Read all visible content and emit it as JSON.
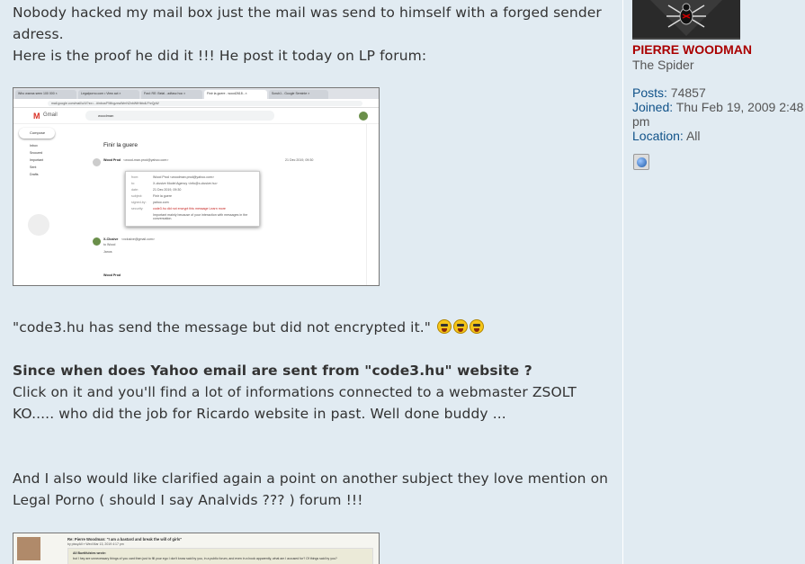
{
  "post": {
    "line1": "Nobody hacked my mail box just the mail was send to himself with a forged sender",
    "line2": "adress.",
    "line3": "Here is the proof he did it !!! He post it today on LP forum:",
    "quote_line": "\"code3.hu has send the message but did not encrypted it.\"",
    "question": "Since when does Yahoo email are sent from \"code3.hu\" website ?",
    "line4": "Click on it and you'll find a lot of informations connected to a webmaster ZSOLT",
    "line5": "KO..... who did the job for Ricardo website in past. Well done buddy ...",
    "line6": "And I also would like clarified again a point on another subject they love mention on",
    "line7": "Legal Porno ( should I say Analvids ??? ) forum !!!",
    "emojis": [
      "laughing-emoji",
      "laughing-emoji",
      "laughing-emoji"
    ]
  },
  "screenshot1": {
    "tabs": [
      "Who wanna seen 100 000 ×",
      "Legalporno.com • View act ×",
      "Fwd: RE: Belal - adfasc hoc ×",
      "Finir la guere - wood2618...×",
      "Scrub1 - Google Seminte ×"
    ],
    "url": "mail.google.com/mail/u/4/?zx=...#inbox/FMfcgzxwWmNZnbWtHbbdLFhrQpW",
    "search": "woodman",
    "app_name": "Gmail",
    "compose": "Compose",
    "sidebar": [
      "Inbox",
      "Snoozed",
      "Important",
      "Sent",
      "Drafts"
    ],
    "inbox_count": "2,097",
    "subject": "Finir la guere",
    "sender": "Wood Prod",
    "sender_email": "<wood-man.prod@yahoo.com>",
    "date": "21 Dec 2019, 09:30",
    "popup_rows": [
      [
        "from:",
        "Wood Prod <woodman.prod@yahoo.com>"
      ],
      [
        "to:",
        "X-clusive Model Agency <info@x-clusive.hu>"
      ],
      [
        "date:",
        "21 Dec 2019, 09:30"
      ],
      [
        "subject:",
        "Finir la guere"
      ],
      [
        "signed-by:",
        "yahoo.com"
      ],
      [
        "security:",
        "code3.hu did not encrypt this message  Learn more"
      ],
      [
        "",
        "Important mainly because of your interaction with messages in the conversation."
      ]
    ],
    "reply_sender": "X-Clusive",
    "reply_email": "<xclusive@gmail.com>",
    "reply_to": "to Wood",
    "reply_name": "Janos",
    "last_sender": "Wood Prod"
  },
  "screenshot2": {
    "title": "Re: Pierre Woodman: \"I am a bastard and break the will of girls\"",
    "by": "by pissyAll » Wed Mar 13, 2019 4:17 pm",
    "quote1": "All Buetifulstes wrote:",
    "quote2": "but I hey are unnecessary things of you cant then just to fill your ego I don't know said by you, in a public forum, and even in a book apparently, what am I accused for? Of things said by you?"
  },
  "profile": {
    "name": "PIERRE WOODMAN",
    "rank": "The Spider",
    "posts_label": "Posts:",
    "posts_value": "74857",
    "joined_label": "Joined:",
    "joined_value": "Thu Feb 19, 2009 2:48",
    "joined_value2": "pm",
    "location_label": "Location:",
    "location_value": "All"
  },
  "colors": {
    "background": "#e1ebf2",
    "username": "#aa0000",
    "label": "#105289",
    "text": "#333333"
  }
}
